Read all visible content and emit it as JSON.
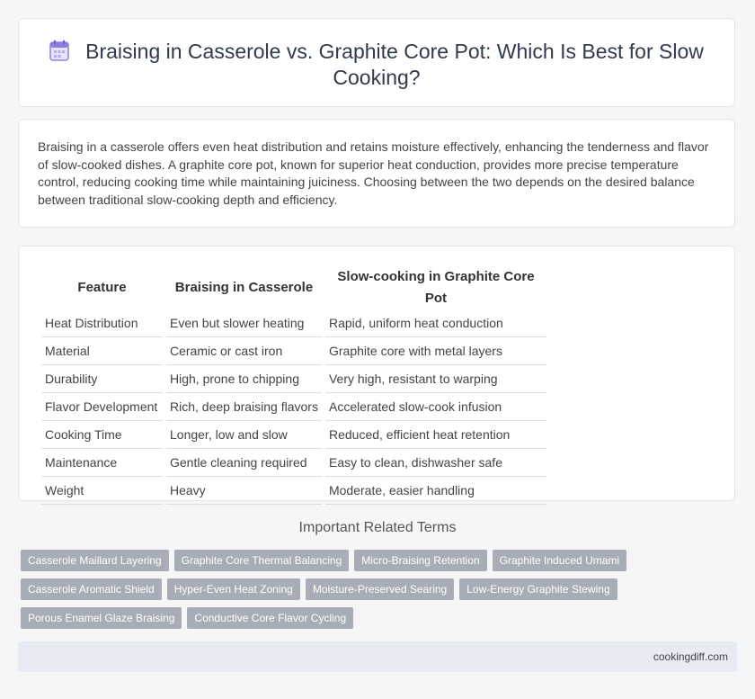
{
  "header": {
    "icon": "calendar-icon",
    "title": "Braising in Casserole vs. Graphite Core Pot: Which Is Best for Slow Cooking?"
  },
  "summary": "Braising in a casserole offers even heat distribution and retains moisture effectively, enhancing the tenderness and flavor of slow-cooked dishes. A graphite core pot, known for superior heat conduction, provides more precise temperature control, reducing cooking time while maintaining juiciness. Choosing between the two depends on the desired balance between traditional slow-cooking depth and efficiency.",
  "table": {
    "headers": [
      "Feature",
      "Braising in Casserole",
      "Slow-cooking in Graphite Core Pot"
    ],
    "rows": [
      [
        "Heat Distribution",
        "Even but slower heating",
        "Rapid, uniform heat conduction"
      ],
      [
        "Material",
        "Ceramic or cast iron",
        "Graphite core with metal layers"
      ],
      [
        "Durability",
        "High, prone to chipping",
        "Very high, resistant to warping"
      ],
      [
        "Flavor Development",
        "Rich, deep braising flavors",
        "Accelerated slow-cook infusion"
      ],
      [
        "Cooking Time",
        "Longer, low and slow",
        "Reduced, efficient heat retention"
      ],
      [
        "Maintenance",
        "Gentle cleaning required",
        "Easy to clean, dishwasher safe"
      ],
      [
        "Weight",
        "Heavy",
        "Moderate, easier handling"
      ]
    ]
  },
  "related": {
    "title": "Important Related Terms",
    "tags": [
      "Casserole Maillard Layering",
      "Graphite Core Thermal Balancing",
      "Micro-Braising Retention",
      "Graphite Induced Umami",
      "Casserole Aromatic Shield",
      "Hyper-Even Heat Zoning",
      "Moisture-Preserved Searing",
      "Low-Energy Graphite Stewing",
      "Porous Enamel Glaze Braising",
      "Conductive Core Flavor Cycling"
    ]
  },
  "footer": {
    "site": "cookingdiff.com"
  }
}
